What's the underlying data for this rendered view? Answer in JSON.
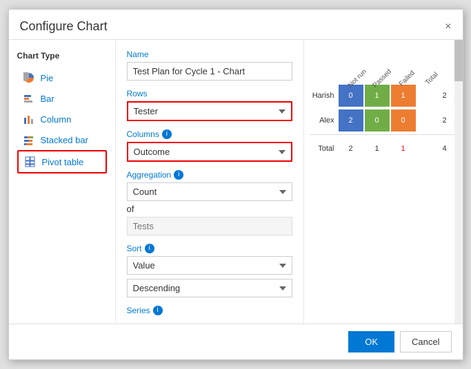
{
  "dialog": {
    "title": "Configure Chart",
    "close_label": "×"
  },
  "chart_type": {
    "label": "Chart Type",
    "items": [
      {
        "id": "pie",
        "label": "Pie",
        "icon": "pie"
      },
      {
        "id": "bar",
        "label": "Bar",
        "icon": "bar"
      },
      {
        "id": "column",
        "label": "Column",
        "icon": "column"
      },
      {
        "id": "stacked-bar",
        "label": "Stacked bar",
        "icon": "stacked-bar"
      },
      {
        "id": "pivot-table",
        "label": "Pivot table",
        "icon": "pivot",
        "selected": true
      }
    ]
  },
  "config": {
    "name_label": "Name",
    "name_value": "Test Plan for Cycle 1 - Chart",
    "rows_label": "Rows",
    "rows_value": "Tester",
    "columns_label": "Columns",
    "columns_value": "Outcome",
    "aggregation_label": "Aggregation",
    "aggregation_value": "Count",
    "of_label": "of",
    "of_placeholder": "Tests",
    "sort_label": "Sort",
    "sort_value": "Value",
    "sort_direction": "Descending",
    "series_label": "Series"
  },
  "preview": {
    "col_headers": [
      "Not run",
      "Passed",
      "Failed",
      "Total"
    ],
    "rows": [
      {
        "label": "Harish",
        "cells": [
          {
            "value": "0",
            "color": "blue"
          },
          {
            "value": "1",
            "color": "green"
          },
          {
            "value": "1",
            "color": "orange"
          }
        ],
        "total": "2"
      },
      {
        "label": "Alex",
        "cells": [
          {
            "value": "2",
            "color": "blue"
          },
          {
            "value": "0",
            "color": "green"
          },
          {
            "value": "0",
            "color": "orange"
          }
        ],
        "total": "2"
      }
    ],
    "total_row": {
      "label": "Total",
      "values": [
        "2",
        "1",
        "1",
        "4"
      ]
    }
  },
  "footer": {
    "ok_label": "OK",
    "cancel_label": "Cancel"
  }
}
